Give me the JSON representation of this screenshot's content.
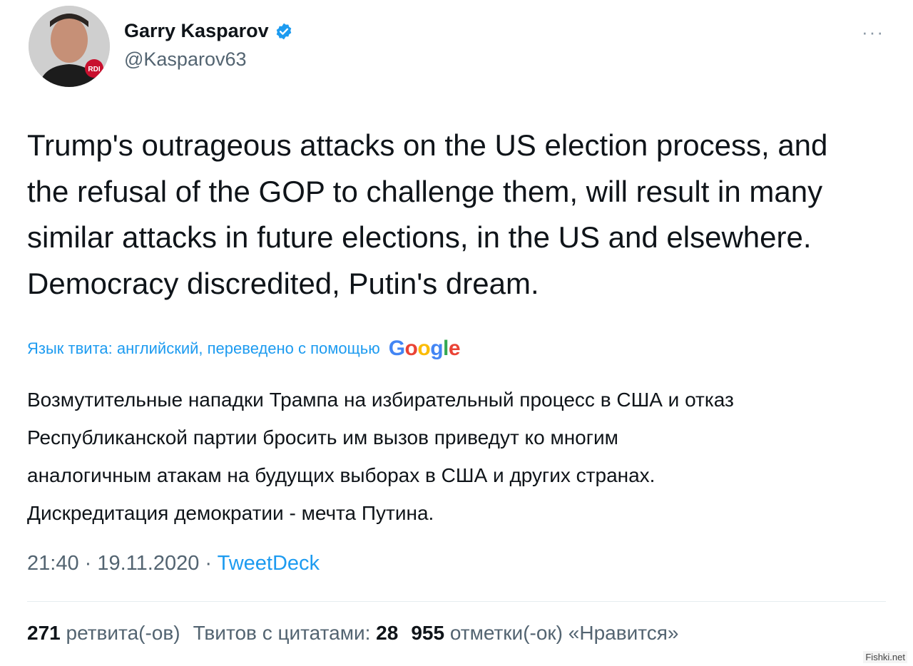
{
  "author": {
    "name": "Garry Kasparov",
    "handle": "@Kasparov63",
    "avatar_badge": "RDI",
    "verified_icon": "verified-badge-icon"
  },
  "menu": {
    "more_label": "···"
  },
  "tweet": {
    "lines": [
      "Trump's outrageous attacks on the US election process, and",
      "the refusal of the GOP to challenge them, will result in many",
      "similar attacks in future elections, in the US and elsewhere.",
      "Democracy discredited, Putin's dream."
    ]
  },
  "translation": {
    "label": "Язык твита: английский, переведено с помощью",
    "provider_letters": [
      "G",
      "o",
      "o",
      "g",
      "l",
      "e"
    ],
    "provider_colors": [
      "#4285F4",
      "#EA4335",
      "#FBBC05",
      "#4285F4",
      "#34A853",
      "#EA4335"
    ],
    "lines": [
      "Возмутительные нападки Трампа на избирательный процесс в США и отказ",
      "Республиканской партии бросить им вызов приведут ко многим",
      "аналогичным атакам на будущих выборах в США и других странах.",
      "Дискредитация демократии - мечта Путина."
    ]
  },
  "meta": {
    "time": "21:40",
    "separator": " · ",
    "date": "19.11.2020",
    "source": "TweetDeck"
  },
  "stats": {
    "retweets_count": "271",
    "retweets_label": "ретвита(-ов)",
    "quotes_label": "Твитов с цитатами:",
    "quotes_count": "28",
    "likes_count": "955",
    "likes_label": "отметки(-ок) «Нравится»"
  },
  "watermark": "Fishki.net",
  "colors": {
    "accent": "#1d9bf0",
    "muted": "#536471",
    "text": "#0f1419"
  }
}
